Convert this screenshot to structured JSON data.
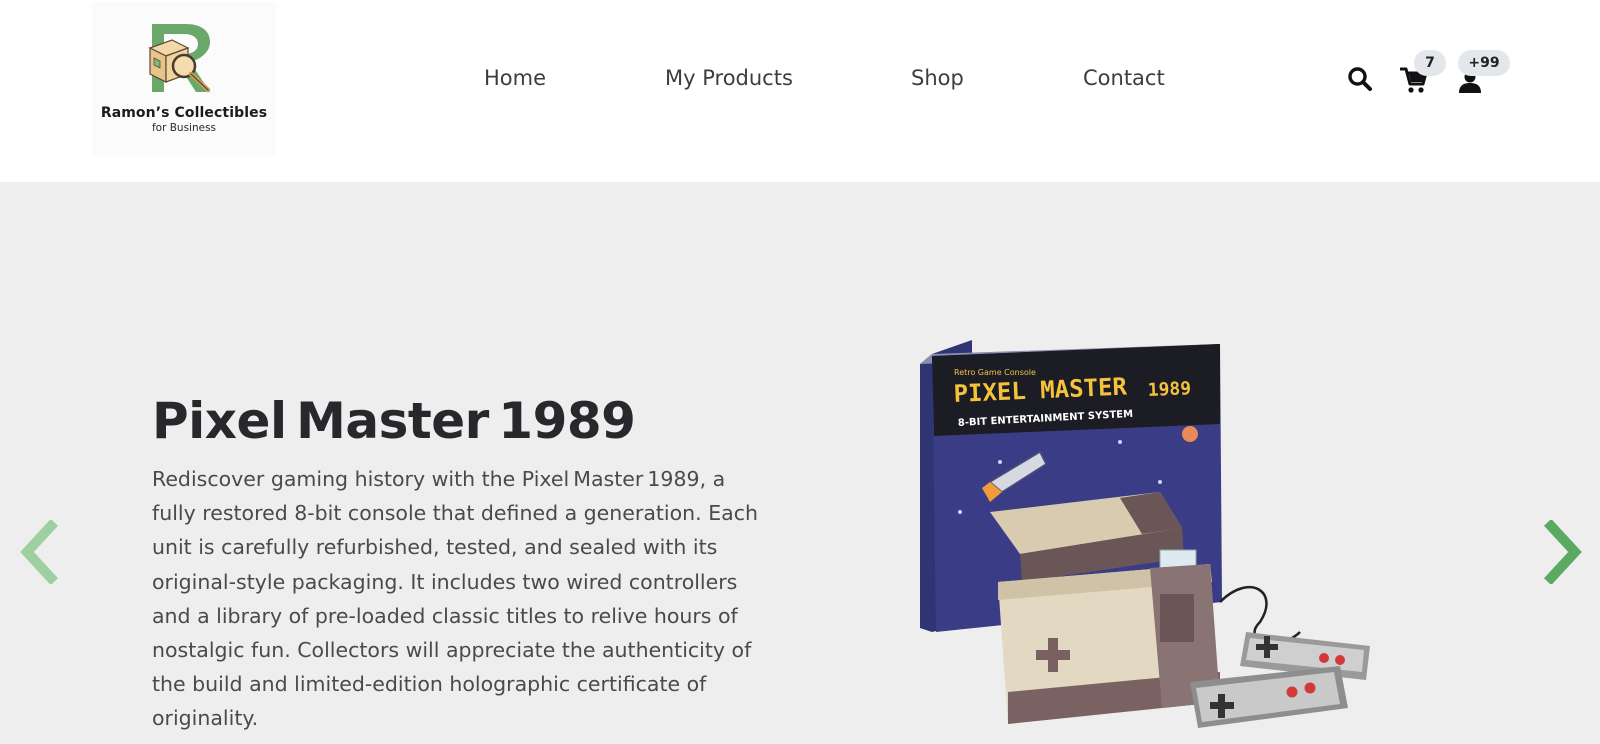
{
  "brand": {
    "name": "Ramon’s Collectibles",
    "tagline": "for Business",
    "accent": "#6aa86a"
  },
  "nav": {
    "items": [
      {
        "label": "Home"
      },
      {
        "label": "My Products"
      },
      {
        "label": "Shop"
      },
      {
        "label": "Contact"
      }
    ]
  },
  "header_icons": {
    "search": "search-icon",
    "cart": "cart-icon",
    "user": "user-icon",
    "cart_count": "7",
    "user_count": "+99"
  },
  "hero": {
    "title": "Pixel Master 1989",
    "description": "Rediscover gaming history with the Pixel Master 1989, a fully restored 8-bit console that defined a generation. Each unit is carefully refurbished, tested, and sealed with its original-style packaging. It includes two wired controllers and a library of pre-loaded classic titles to relive hours of nostalgic fun. Collectors will appreciate the authenticity of the build and limited-edition holographic certificate of originality.",
    "box_brand": "Retro Game Console",
    "box_title": "PIXEL MASTER",
    "box_year": "1989",
    "box_subtitle": "8-BIT ENTERTAINMENT SYSTEM",
    "prev_icon": "chevron-left-icon",
    "next_icon": "chevron-right-icon",
    "background": "#eeeeee"
  }
}
